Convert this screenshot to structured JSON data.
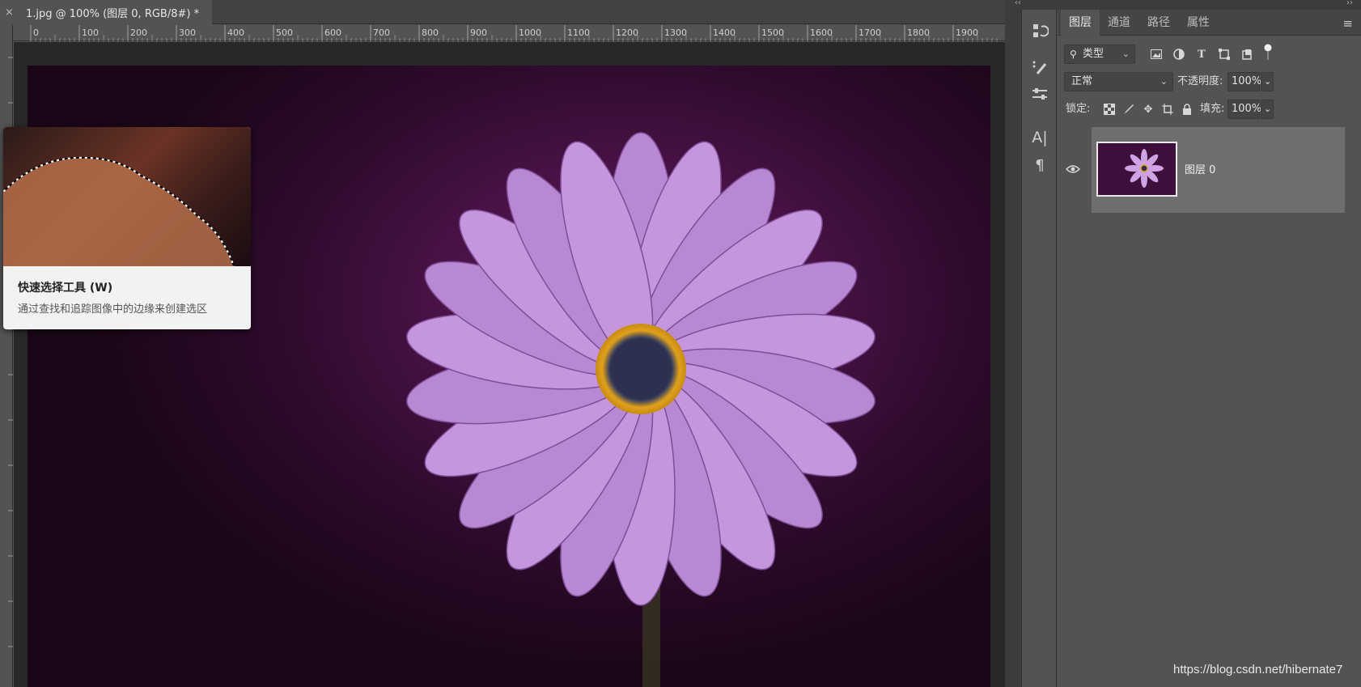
{
  "document": {
    "tab_title": "1.jpg @ 100% (图层 0, RGB/8#) *",
    "close_glyph": "×"
  },
  "ruler": {
    "ticks": [
      "0",
      "100",
      "200",
      "300",
      "400",
      "500",
      "600",
      "700",
      "800",
      "900",
      "1000",
      "1100",
      "1200",
      "1300",
      "1400",
      "1500",
      "1600",
      "1700",
      "1800",
      "1900"
    ]
  },
  "tooltip": {
    "title": "快速选择工具 (W)",
    "description": "通过查找和追踪图像中的边缘来创建选区"
  },
  "side_toolbar": {
    "icons": [
      "history-brush-icon",
      "brush-presets-icon",
      "adjustments-icon",
      "character-icon",
      "paragraph-icon"
    ]
  },
  "layers_panel": {
    "tabs": [
      "图层",
      "通道",
      "路径",
      "属性"
    ],
    "active_tab": "图层",
    "filter": {
      "label": "类型"
    },
    "blend_mode": "正常",
    "opacity_label": "不透明度:",
    "opacity_value": "100%",
    "lock_label": "锁定:",
    "fill_label": "填充:",
    "fill_value": "100%",
    "layers": [
      {
        "name": "图层 0",
        "visible": true
      }
    ]
  },
  "watermark": "https://blog.csdn.net/hibernate7",
  "colors": {
    "ui_bg": "#535353",
    "panel_dark": "#454545",
    "canvas_purple": "#4a1246",
    "petal": "#c99be0"
  }
}
